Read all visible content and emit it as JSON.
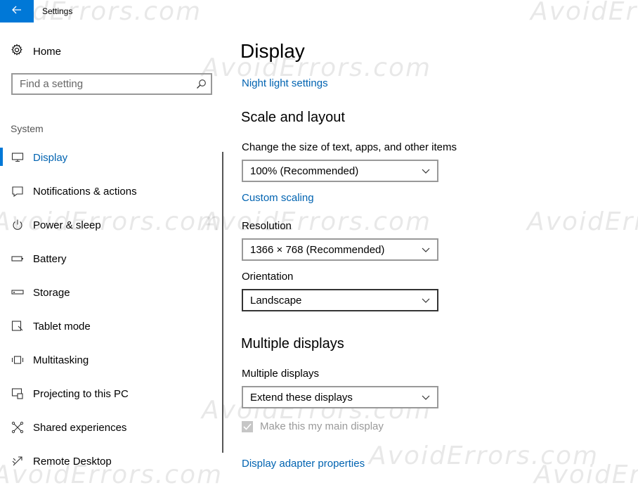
{
  "window": {
    "title": "Settings"
  },
  "nav": {
    "home_label": "Home",
    "search_placeholder": "Find a setting",
    "section_label": "System",
    "items": [
      {
        "label": "Display",
        "icon": "monitor-icon",
        "active": true
      },
      {
        "label": "Notifications & actions",
        "icon": "notification-icon"
      },
      {
        "label": "Power & sleep",
        "icon": "power-icon"
      },
      {
        "label": "Battery",
        "icon": "battery-icon"
      },
      {
        "label": "Storage",
        "icon": "storage-icon"
      },
      {
        "label": "Tablet mode",
        "icon": "tablet-icon"
      },
      {
        "label": "Multitasking",
        "icon": "multitasking-icon"
      },
      {
        "label": "Projecting to this PC",
        "icon": "projecting-icon"
      },
      {
        "label": "Shared experiences",
        "icon": "shared-icon"
      },
      {
        "label": "Remote Desktop",
        "icon": "remote-desktop-icon"
      }
    ]
  },
  "main": {
    "title": "Display",
    "night_light_link": "Night light settings",
    "scale_heading": "Scale and layout",
    "scale_label": "Change the size of text, apps, and other items",
    "scale_value": "100% (Recommended)",
    "custom_scaling_link": "Custom scaling",
    "resolution_label": "Resolution",
    "resolution_value": "1366 × 768 (Recommended)",
    "orientation_label": "Orientation",
    "orientation_value": "Landscape",
    "multiple_heading": "Multiple displays",
    "multiple_label": "Multiple displays",
    "multiple_value": "Extend these displays",
    "main_display_checkbox": "Make this my main display",
    "main_display_checked": true,
    "adapter_link": "Display adapter properties"
  },
  "watermark": "AvoidErrors.com",
  "colors": {
    "accent": "#0078d7",
    "link": "#0063b1"
  }
}
